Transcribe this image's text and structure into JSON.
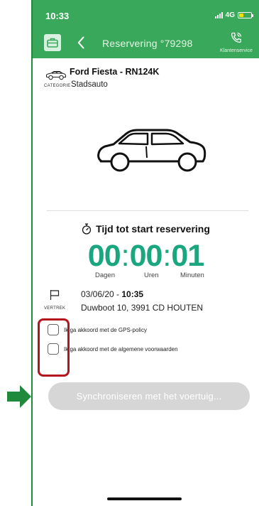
{
  "status_bar": {
    "time": "10:33",
    "network": "4G"
  },
  "nav": {
    "title": "Reservering °79298",
    "service_label": "Klantenservice"
  },
  "vehicle": {
    "name": "Ford Fiesta - RN124K",
    "category_label": "CATEGORIE",
    "category_value": "Stadsauto"
  },
  "timer": {
    "title": "Tijd tot start reservering",
    "days": "00",
    "hours": "00",
    "minutes": "01",
    "days_label": "Dagen",
    "hours_label": "Uren",
    "minutes_label": "Minuten"
  },
  "departure": {
    "label": "VERTREK",
    "date": "03/06/20 - ",
    "time": "10:35",
    "address": "Duwboot 10, 3991 CD HOUTEN"
  },
  "agreements": [
    {
      "label": "Ik ga akkoord met de GPS-policy",
      "checked": false
    },
    {
      "label": "Ik ga akkoord met de algemene voorwaarden",
      "checked": false
    }
  ],
  "sync_button": {
    "label": "Synchroniseren met het voertuig..."
  },
  "colors": {
    "header": "#3aa85a",
    "timer": "#1aa67e",
    "highlight": "#b3141d",
    "disabled_button": "#d6d6d6",
    "arrow": "#1f8a3c"
  },
  "icons": [
    "briefcase-icon",
    "chevron-left-icon",
    "phone-icon",
    "car-small-icon",
    "car-large-icon",
    "stopwatch-icon",
    "flag-icon",
    "arrow-right-icon"
  ]
}
